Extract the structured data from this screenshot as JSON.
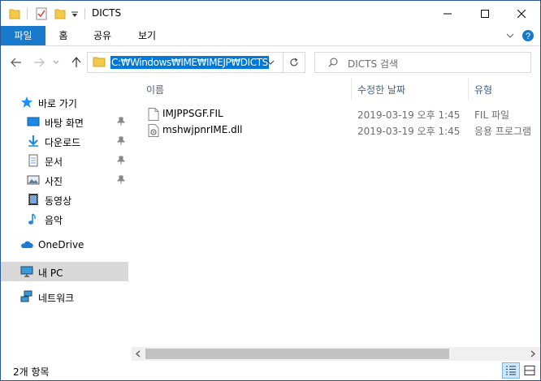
{
  "window": {
    "title": "DICTS",
    "minimize_icon": "minimize-icon",
    "maximize_icon": "maximize-icon",
    "close_icon": "close-icon"
  },
  "ribbon": {
    "tabs": [
      {
        "label": "파일"
      },
      {
        "label": "홈"
      },
      {
        "label": "공유"
      },
      {
        "label": "보기"
      }
    ]
  },
  "address": {
    "path": "C:₩Windows₩IME₩IMEJP₩DICTS"
  },
  "search": {
    "placeholder": "DICTS 검색"
  },
  "nav": {
    "quick_access": "바로 가기",
    "items": [
      {
        "label": "바탕 화면",
        "icon": "desktop-icon",
        "pinned": true
      },
      {
        "label": "다운로드",
        "icon": "download-icon",
        "pinned": true
      },
      {
        "label": "문서",
        "icon": "document-icon",
        "pinned": true
      },
      {
        "label": "사진",
        "icon": "pictures-icon",
        "pinned": true
      },
      {
        "label": "동영상",
        "icon": "video-icon",
        "pinned": false
      },
      {
        "label": "음악",
        "icon": "music-icon",
        "pinned": false
      }
    ],
    "onedrive": "OneDrive",
    "this_pc": "내 PC",
    "network": "네트워크"
  },
  "columns": {
    "name": "이름",
    "date": "수정한 날짜",
    "type": "유형"
  },
  "files": [
    {
      "name": "IMJPPSGF.FIL",
      "date": "2019-03-19 오후 1:45",
      "type": "FIL 파일",
      "icon": "file-icon"
    },
    {
      "name": "mshwjpnrIME.dll",
      "date": "2019-03-19 오후 1:45",
      "type": "응용 프로그램",
      "icon": "dll-icon"
    }
  ],
  "status": {
    "count": "2개 항목"
  },
  "colors": {
    "accent": "#1979ca",
    "selection": "#0078d7"
  }
}
